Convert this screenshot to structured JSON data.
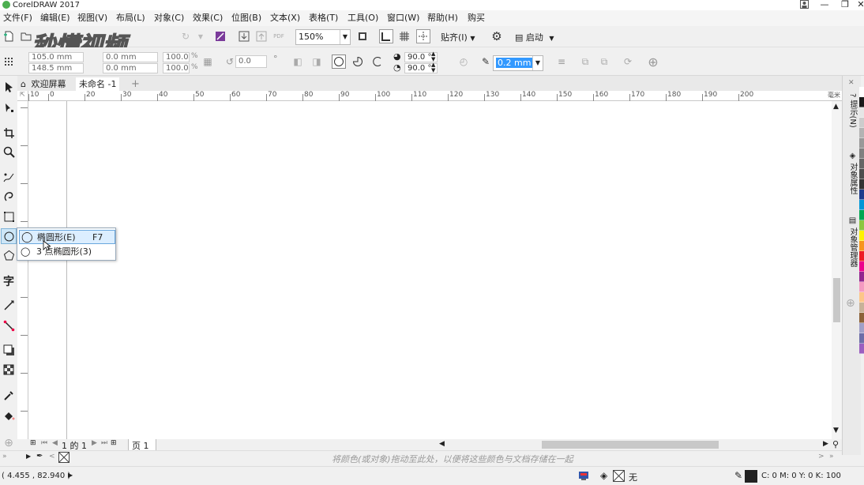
{
  "app": {
    "title": "CorelDRAW 2017"
  },
  "menu": [
    "文件(F)",
    "编辑(E)",
    "视图(V)",
    "布局(L)",
    "对象(C)",
    "效果(C)",
    "位图(B)",
    "文本(X)",
    "表格(T)",
    "工具(O)",
    "窗口(W)",
    "帮助(H)",
    "购买"
  ],
  "watermark": {
    "text": "秒懂视频"
  },
  "toolbar": {
    "zoom_value": "150%",
    "snap_label": "贴齐(I)",
    "launch_label": "启动"
  },
  "propertybar": {
    "x_value": "105.0 mm",
    "y_value": "148.5 mm",
    "w_value": "0.0 mm",
    "h_value": "0.0 mm",
    "scale_x": "100.0",
    "scale_y": "100.0",
    "percent": "%",
    "rotation": "0.0",
    "degree": "°",
    "start_angle": "90.0 °",
    "end_angle": "90.0 °",
    "outline_width": "0.2 mm"
  },
  "document_tabs": {
    "welcome": "欢迎屏幕",
    "untitled": "未命名 -1"
  },
  "ruler": {
    "ticks": [
      "10",
      "0",
      "20",
      "30",
      "40",
      "50",
      "60",
      "70",
      "80",
      "90",
      "100",
      "110",
      "120",
      "130",
      "140",
      "150",
      "160",
      "170",
      "180",
      "190",
      "200"
    ],
    "unit": "毫米"
  },
  "flyout": {
    "items": [
      {
        "label": "椭圆形(E)",
        "shortcut": "F7"
      },
      {
        "label": "3 点椭圆形(3)",
        "shortcut": ""
      }
    ]
  },
  "dockers": {
    "hints": "提示(N)",
    "properties": "对象属性",
    "manager": "对象管理器"
  },
  "palette": {
    "colors": [
      "#ffffff",
      "#1a1a1a",
      "#e6e6e6",
      "#cccccc",
      "#b3b3b3",
      "#999999",
      "#808080",
      "#666666",
      "#4d4d4d",
      "#333333",
      "#1e3c8c",
      "#0096d6",
      "#00a651",
      "#8dc63f",
      "#fff200",
      "#f7941d",
      "#ed1c24",
      "#ec008c",
      "#92278f",
      "#f49ac1",
      "#fdc689",
      "#c7b299",
      "#8c6239",
      "#a0a0c8",
      "#6d6ea8",
      "#9b5fc0"
    ]
  },
  "pagebar": {
    "current": "1",
    "of": "的",
    "total": "1",
    "page_tab": "页 1"
  },
  "colorbar": {
    "hint": "将颜色(或对象)拖动至此处，以便将这些颜色与文档存储在一起"
  },
  "status": {
    "coords": "( 4.455 , 82.940 )",
    "fill_none": "无",
    "outline_info": "C: 0 M: 0 Y: 0 K: 100"
  }
}
